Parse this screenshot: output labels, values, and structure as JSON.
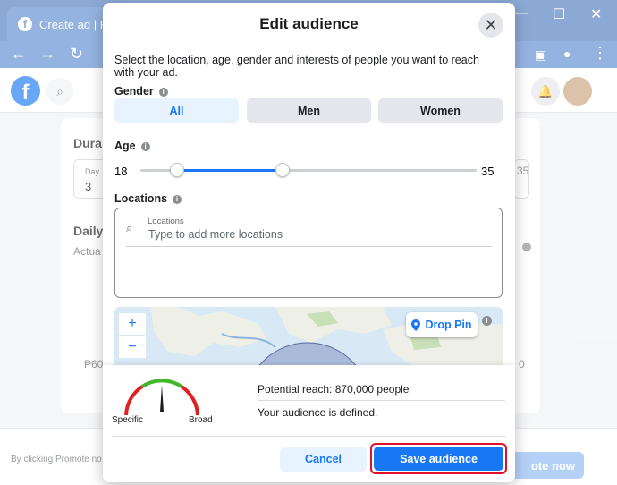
{
  "browser": {
    "tab_title": "Create ad | Fa",
    "favicon": "f",
    "minimize": "—",
    "maximize": "☐",
    "close": "✕"
  },
  "facebook": {
    "logo": "f"
  },
  "background": {
    "duration_label": "Dura",
    "duration_sub": "Day",
    "duration_value": "3",
    "daily_label": "Daily",
    "daily_sub": "Actua",
    "peso_value": "₱60",
    "right_value": "35",
    "right_value2": "0",
    "footer_text": "By clicking Promote no",
    "promote_label": "ote now"
  },
  "modal": {
    "title": "Edit audience",
    "description": "Select the location, age, gender and interests of people you want to reach with your ad.",
    "gender": {
      "label": "Gender",
      "options": [
        "All",
        "Men",
        "Women"
      ],
      "selected": "All"
    },
    "age": {
      "label": "Age",
      "min": "18",
      "max": "35"
    },
    "locations": {
      "label": "Locations",
      "field_label": "Locations",
      "placeholder": "Type to add more locations"
    },
    "map": {
      "zoom_in": "+",
      "zoom_out": "−",
      "drop_pin_label": "Drop Pin"
    },
    "reach": {
      "specific_label": "Specific",
      "broad_label": "Broad",
      "potential_reach": "Potential reach: 870,000 people",
      "status": "Your audience is defined."
    },
    "buttons": {
      "cancel": "Cancel",
      "save": "Save audience"
    }
  },
  "colors": {
    "accent": "#1877f2",
    "highlight": "#e0102a"
  }
}
